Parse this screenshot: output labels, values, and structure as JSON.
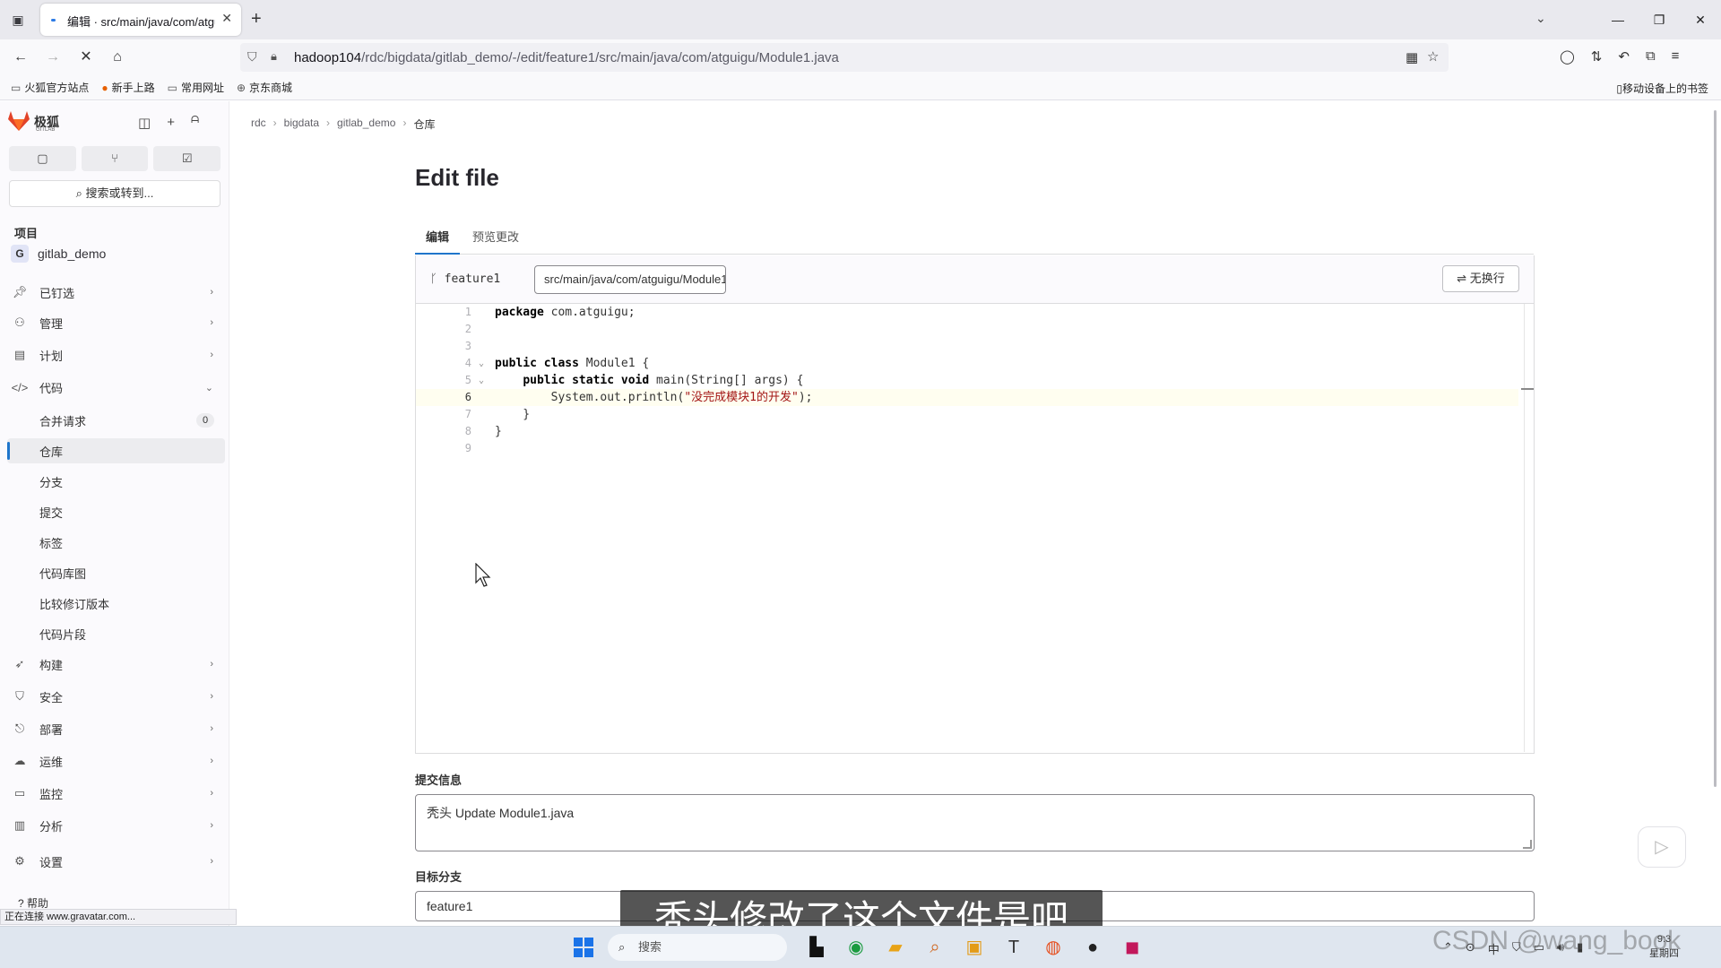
{
  "browser": {
    "tab_title": "编辑 · src/main/java/com/atguigu/Module1.java",
    "url_host": "hadoop104",
    "url_path": "/rdc/bigdata/gitlab_demo/-/edit/feature1/src/main/java/com/atguigu/Module1.java",
    "bookmarks": [
      "火狐官方站点",
      "新手上路",
      "常用网址",
      "京东商城"
    ],
    "bookmarks_right": "移动设备上的书签",
    "status_text": "正在连接 www.gravatar.com..."
  },
  "sidebar": {
    "brand": "极狐",
    "brand_sub": "GITLAB",
    "search_placeholder": "搜索或转到...",
    "section_label": "项目",
    "project_initial": "G",
    "project_name": "gitlab_demo",
    "items": [
      {
        "icon": "pin-icon",
        "label": "已钉选"
      },
      {
        "icon": "manage-icon",
        "label": "管理"
      },
      {
        "icon": "plan-icon",
        "label": "计划"
      },
      {
        "icon": "code-icon",
        "label": "代码"
      }
    ],
    "code_sub": [
      {
        "label": "合并请求",
        "badge": "0"
      },
      {
        "label": "仓库"
      },
      {
        "label": "分支"
      },
      {
        "label": "提交"
      },
      {
        "label": "标签"
      },
      {
        "label": "代码库图"
      },
      {
        "label": "比较修订版本"
      },
      {
        "label": "代码片段"
      }
    ],
    "items_bottom": [
      {
        "icon": "rocket-icon",
        "label": "构建"
      },
      {
        "icon": "shield-icon",
        "label": "安全"
      },
      {
        "icon": "deploy-icon",
        "label": "部署"
      },
      {
        "icon": "operate-icon",
        "label": "运维"
      },
      {
        "icon": "monitor-icon",
        "label": "监控"
      },
      {
        "icon": "chart-icon",
        "label": "分析"
      },
      {
        "icon": "gear-icon",
        "label": "设置"
      }
    ],
    "help": "帮助"
  },
  "breadcrumb": [
    "rdc",
    "bigdata",
    "gitlab_demo",
    "仓库"
  ],
  "page": {
    "title": "Edit file",
    "tabs": [
      "编辑",
      "预览更改"
    ]
  },
  "editor": {
    "branch": "feature1",
    "file_path": "src/main/java/com/atguigu/Module1.java",
    "nowrap_label": "无换行",
    "current_line": 6
  },
  "commit": {
    "message_label": "提交信息",
    "message": "秃头 Update Module1.java",
    "target_label": "目标分支",
    "target_branch": "feature1"
  },
  "caption": "秃头修改了这个文件是吧",
  "watermark": "CSDN @wang_book",
  "taskbar": {
    "search_label": "搜索",
    "time": "9:3",
    "date": "星期四"
  }
}
